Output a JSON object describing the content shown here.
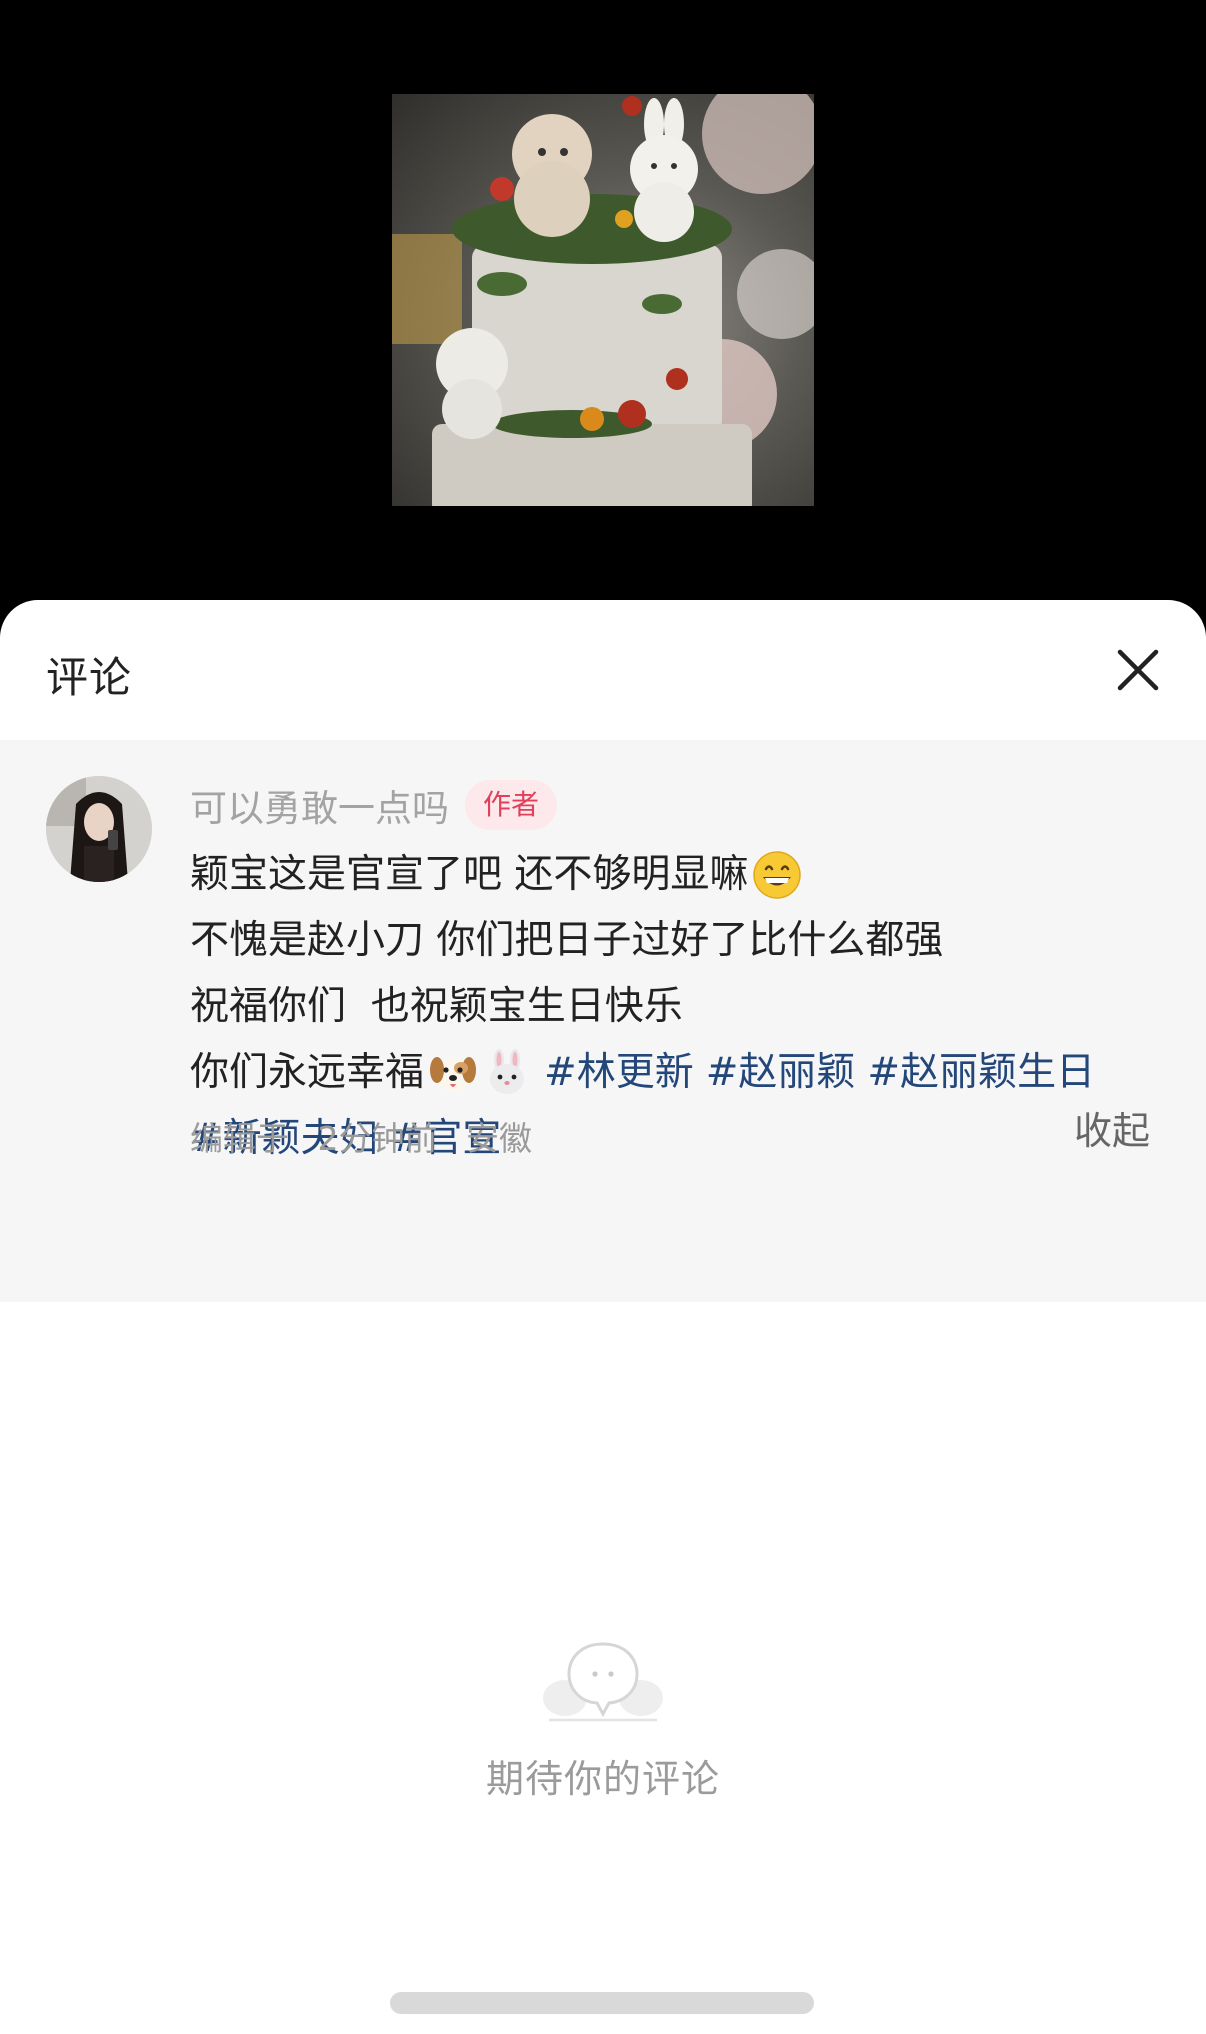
{
  "sheet": {
    "title": "评论"
  },
  "comment": {
    "author_name": "可以勇敢一点吗",
    "author_badge": "作者",
    "lines": [
      "颖宝这是官宣了吧 还不够明显嘛",
      "不愧是赵小刀 你们把日子过好了比什么都强",
      "祝福你们  也祝颖宝生日快乐",
      "你们永远幸福"
    ],
    "emojis": [
      "grinning-face-emoji",
      "dog-face-emoji",
      "rabbit-face-emoji"
    ],
    "hashtags": [
      "#林更新",
      "#赵丽颖",
      "#赵丽颖生日",
      "#新颖夫妇",
      "#官宣"
    ],
    "meta": {
      "edited_prefix": "编辑于",
      "time": "2分钟前",
      "location": "安徽"
    },
    "collapse_label": "收起"
  },
  "empty_state": {
    "text": "期待你的评论"
  },
  "colors": {
    "hashtag": "#24477a",
    "badge_text": "#e0405a",
    "badge_bg": "#fde8ec",
    "comment_bg": "#f6f6f6"
  }
}
